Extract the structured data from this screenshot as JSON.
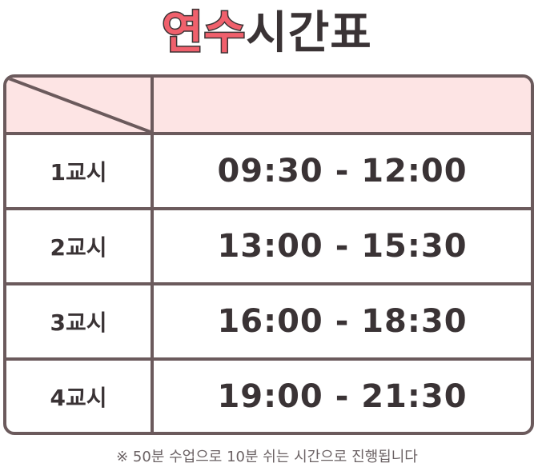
{
  "title": {
    "highlight": "연수",
    "rest": "시간표"
  },
  "schedule": [
    {
      "period": "1교시",
      "time": "09:30 - 12:00"
    },
    {
      "period": "2교시",
      "time": "13:00 - 15:30"
    },
    {
      "period": "3교시",
      "time": "16:00 - 18:30"
    },
    {
      "period": "4교시",
      "time": "19:00 - 21:30"
    }
  ],
  "note": "※ 50분 수업으로 10분 쉬는 시간으로 진행됩니다",
  "colors": {
    "accent": "#f0606c",
    "header_bg": "#fde4e4",
    "border": "#6b5a5c",
    "text": "#3a3335"
  }
}
